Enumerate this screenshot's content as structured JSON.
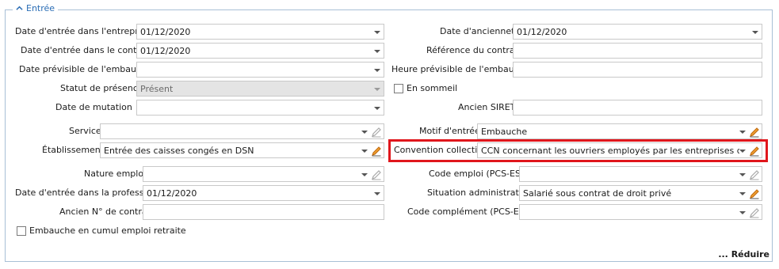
{
  "section": {
    "title": "Entrée"
  },
  "left": {
    "date_entree_entreprise": {
      "label": "Date d'entrée dans l'entreprise",
      "value": "01/12/2020"
    },
    "date_entree_contrat": {
      "label": "Date d'entrée dans le contrat",
      "value": "01/12/2020"
    },
    "date_previsible_embauche": {
      "label": "Date prévisible de l'embauche",
      "value": ""
    },
    "statut_presence": {
      "label": "Statut de présence",
      "value": "Présent"
    },
    "date_mutation": {
      "label": "Date de mutation",
      "value": ""
    },
    "service": {
      "label": "Service",
      "value": ""
    },
    "etablissement": {
      "label": "Établissement",
      "value": "Entrée des caisses congés en DSN"
    },
    "nature_emploi": {
      "label": "Nature emploi",
      "value": ""
    },
    "date_entree_profession": {
      "label": "Date d'entrée dans la profession",
      "value": "01/12/2020"
    },
    "ancien_no_contrat": {
      "label": "Ancien N° de contrat",
      "value": ""
    },
    "embauche_cumul": {
      "label": "Embauche en cumul emploi retraite",
      "checked": false
    }
  },
  "right": {
    "date_anciennete": {
      "label": "Date d'ancienneté",
      "value": "01/12/2020"
    },
    "reference_contrat": {
      "label": "Référence du contrat",
      "value": ""
    },
    "heure_previsible_embauche": {
      "label": "Heure prévisible de l'embauche",
      "value": ""
    },
    "en_sommeil": {
      "label": "En sommeil",
      "checked": false
    },
    "ancien_siret": {
      "label": "Ancien SIRET",
      "value": ""
    },
    "motif_entree": {
      "label": "Motif d'entrée",
      "value": "Embauche"
    },
    "convention_collective": {
      "label": "Convention collective",
      "value": "CCN concernant les ouvriers employés par les entreprises du bâtime"
    },
    "code_emploi": {
      "label": "Code emploi (PCS-ESE)",
      "value": ""
    },
    "situation_administrative": {
      "label": "Situation administrative",
      "value": "Salarié sous contrat de droit privé"
    },
    "code_complement": {
      "label": "Code complément (PCS-ESE)",
      "value": ""
    }
  },
  "footer": {
    "reduire_label": "... Réduire"
  },
  "colors": {
    "accent": "#2a6db5",
    "highlight": "#e0161c",
    "pencil_active": "#e07b10"
  },
  "icons": [
    "chevron-up-icon",
    "dropdown-arrow-icon",
    "pencil-icon"
  ]
}
